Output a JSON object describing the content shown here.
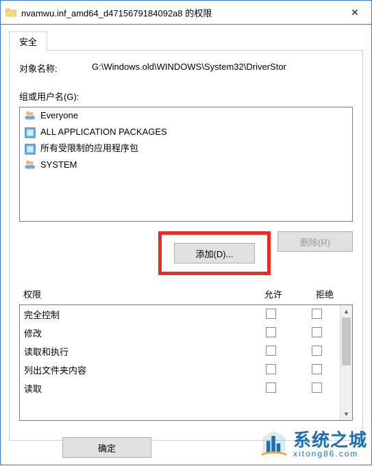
{
  "window": {
    "title": "nvamwu.inf_amd64_d4715679184092a8 的权限",
    "close_glyph": "✕"
  },
  "tabs": {
    "security": "安全"
  },
  "object": {
    "label": "对象名称:",
    "path": "G:\\Windows.old\\WINDOWS\\System32\\DriverStor"
  },
  "groups": {
    "label": "组或用户名(G):",
    "items": [
      {
        "name": "Everyone",
        "icon": "users"
      },
      {
        "name": "ALL APPLICATION PACKAGES",
        "icon": "package"
      },
      {
        "name": "所有受限制的应用程序包",
        "icon": "package"
      },
      {
        "name": "SYSTEM",
        "icon": "users"
      }
    ]
  },
  "buttons": {
    "add": "添加(D)...",
    "remove": "删除(R)",
    "ok": "确定"
  },
  "permissions": {
    "label": "权限",
    "allow_label": "允许",
    "deny_label": "拒绝",
    "rows": [
      "完全控制",
      "修改",
      "读取和执行",
      "列出文件夹内容",
      "读取"
    ]
  },
  "watermark": {
    "title": "系统之城",
    "sub": "xitong86.com"
  },
  "colors": {
    "accent": "#3a78c4",
    "highlight": "#ee2a24",
    "brand": "#1b6fb5"
  }
}
